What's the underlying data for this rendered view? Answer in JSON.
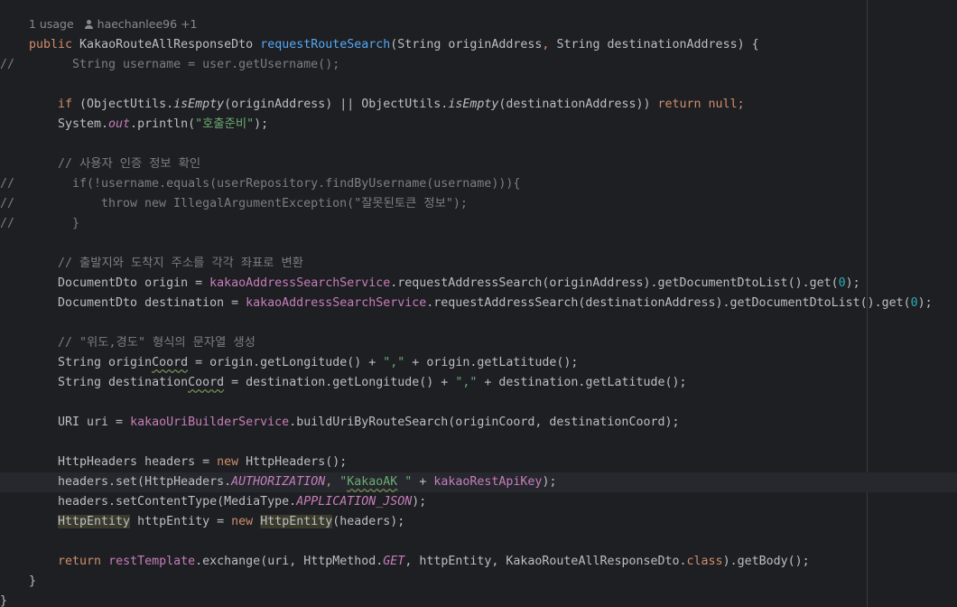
{
  "inlay_hint": {
    "usages": "1 usage",
    "author": "haechanlee96",
    "more": "+1"
  },
  "icons": {
    "author": "person-icon"
  },
  "colors": {
    "background": "#1e1f22",
    "keyword": "#cf8e6d",
    "function": "#56a8f5",
    "string": "#6aab73",
    "number": "#2aacb8",
    "comment": "#7a7e85",
    "field": "#c77dbb",
    "text": "#bcbec4"
  },
  "code": {
    "sig": {
      "public": "public",
      "return_type": " KakaoRouteAllResponseDto ",
      "method": "requestRouteSearch",
      "open": "(String originAddress",
      "comma": ",",
      "rest": " String destinationAddress) {"
    },
    "c1": {
      "mark": "//",
      "text": "String username = user.getUsername();"
    },
    "if_line": {
      "if": "if",
      "p1": " (ObjectUtils.",
      "isEmpty": "isEmpty",
      "p2": "(originAddress) || ObjectUtils.",
      "p3": "(destinationAddress)) ",
      "ret": "return",
      "sp": " ",
      "null": "null",
      "semi": ";"
    },
    "print": {
      "p1": "System.",
      "out": "out",
      "p2": ".println(",
      "str": "\"호출준비\"",
      "p3": ");"
    },
    "cm_user": "// 사용자 인증 정보 확인",
    "c2": {
      "mark": "//",
      "text": "if(!username.equals(userRepository.findByUsername(username))){"
    },
    "c3": {
      "mark": "//",
      "text": "throw new IllegalArgumentException(\"잘못된토큰 정보\");"
    },
    "c4": {
      "mark": "//",
      "text": "}"
    },
    "cm_convert": "// 출발지와 도착지 주소를 각각 좌표로 변환",
    "origin": {
      "p1": "DocumentDto origin = ",
      "field": "kakaoAddressSearchService",
      "p2": ".requestAddressSearch(originAddress).getDocumentDtoList().get(",
      "num": "0",
      "p3": ");"
    },
    "dest": {
      "p1": "DocumentDto destination = ",
      "field": "kakaoAddressSearchService",
      "p2": ".requestAddressSearch(destinationAddress).getDocumentDtoList().get(",
      "num": "0",
      "p3": ");"
    },
    "cm_coord": "// \"위도,경도\" 형식의 문자열 생성",
    "oc": {
      "p1": "String origin",
      "warn": "Coord",
      "p2": " = origin.getLongitude() + ",
      "str": "\",\"",
      "p3": " + origin.getLatitude();"
    },
    "dc": {
      "p1": "String destination",
      "warn": "Coord",
      "p2": " = destination.getLongitude() + ",
      "str": "\",\"",
      "p3": " + destination.getLatitude();"
    },
    "uri": {
      "p1": "URI uri = ",
      "field": "kakaoUriBuilderService",
      "p2": ".buildUriByRouteSearch(originCoord, destinationCoord);"
    },
    "hh": {
      "p1": "HttpHeaders headers = ",
      "new": "new",
      "p2": " HttpHeaders();"
    },
    "hs": {
      "p1": "headers.set(HttpHeaders.",
      "const": "AUTHORIZATION",
      "comma": ", ",
      "q1": "\"",
      "warn": "KakaoAK",
      "q2": " \"",
      "plus": " + ",
      "field": "kakaoRestApiKey",
      "end": ");"
    },
    "hct": {
      "p1": "headers.setContentType(MediaType.",
      "const": "APPLICATION_JSON",
      "end": ");"
    },
    "he": {
      "type": "HttpEntity",
      "p1": " httpEntity = ",
      "new": "new",
      "sp": " ",
      "type2": "HttpEntity",
      "p2": "(headers);"
    },
    "ret": {
      "return": "return",
      "sp": " ",
      "field": "restTemplate",
      "p1": ".exchange(uri, HttpMethod.",
      "const": "GET",
      "p2": ", httpEntity, KakaoRouteAllResponseDto.",
      "cls": "class",
      "p3": ").getBody();"
    },
    "close_method": "}",
    "close_class": "}"
  }
}
